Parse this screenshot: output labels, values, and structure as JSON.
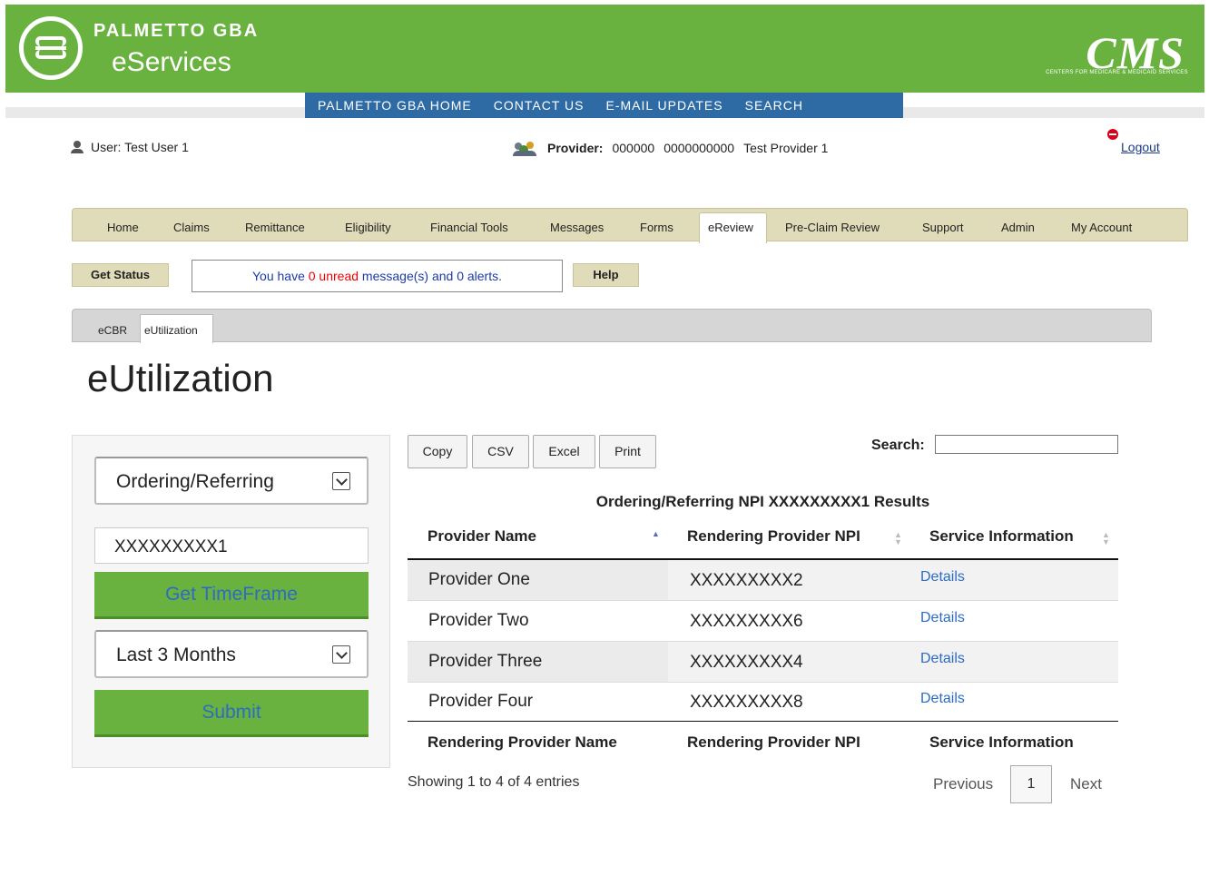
{
  "header": {
    "brand_line1": "PALMETTO GBA",
    "brand_line2": "eServices",
    "cms_logo": "CMS",
    "cms_sub": "CENTERS FOR MEDICARE & MEDICAID SERVICES"
  },
  "topnav": [
    "PALMETTO GBA HOME",
    "CONTACT US",
    "E-MAIL UPDATES",
    "SEARCH"
  ],
  "user": {
    "label": "User:",
    "value": "Test User 1"
  },
  "provider": {
    "label": "Provider:",
    "id": "000000",
    "npi": "0000000000",
    "name": "Test Provider 1"
  },
  "logout": "Logout",
  "mainnav": [
    "Home",
    "Claims",
    "Remittance",
    "Eligibility",
    "Financial Tools",
    "Messages",
    "Forms",
    "eReview",
    "Pre-Claim Review",
    "Support",
    "Admin",
    "My Account"
  ],
  "mainnav_active": "eReview",
  "toolbar": {
    "get_status": "Get Status",
    "help": "Help",
    "msg_pre": "You have ",
    "msg_unread_count": "0",
    "msg_unread": " unread",
    "msg_post": " message(s) and 0 alerts."
  },
  "subtabs": [
    "eCBR",
    "eUtilization"
  ],
  "page_title": "eUtilization",
  "form": {
    "type_select": "Ordering/Referring",
    "npi_value": "XXXXXXXXX1",
    "timeframe_btn": "Get TimeFrame",
    "range_select": "Last 3 Months",
    "submit_btn": "Submit"
  },
  "table_buttons": [
    "Copy",
    "CSV",
    "Excel",
    "Print"
  ],
  "search_label": "Search:",
  "caption": "Ordering/Referring NPI XXXXXXXXX1 Results",
  "columns": [
    "Provider Name",
    "Rendering Provider NPI",
    "Service Information"
  ],
  "footer_columns": [
    "Rendering Provider Name",
    "Rendering Provider NPI",
    "Service Information"
  ],
  "rows": [
    {
      "name": "Provider One",
      "npi": "XXXXXXXXX2",
      "link": "Details"
    },
    {
      "name": "Provider Two",
      "npi": "XXXXXXXXX6",
      "link": "Details"
    },
    {
      "name": "Provider Three",
      "npi": "XXXXXXXXX4",
      "link": "Details"
    },
    {
      "name": "Provider Four",
      "npi": "XXXXXXXXX8",
      "link": "Details"
    }
  ],
  "showing": "Showing 1 to 4 of 4 entries",
  "pagination": {
    "prev": "Previous",
    "page": "1",
    "next": "Next"
  }
}
